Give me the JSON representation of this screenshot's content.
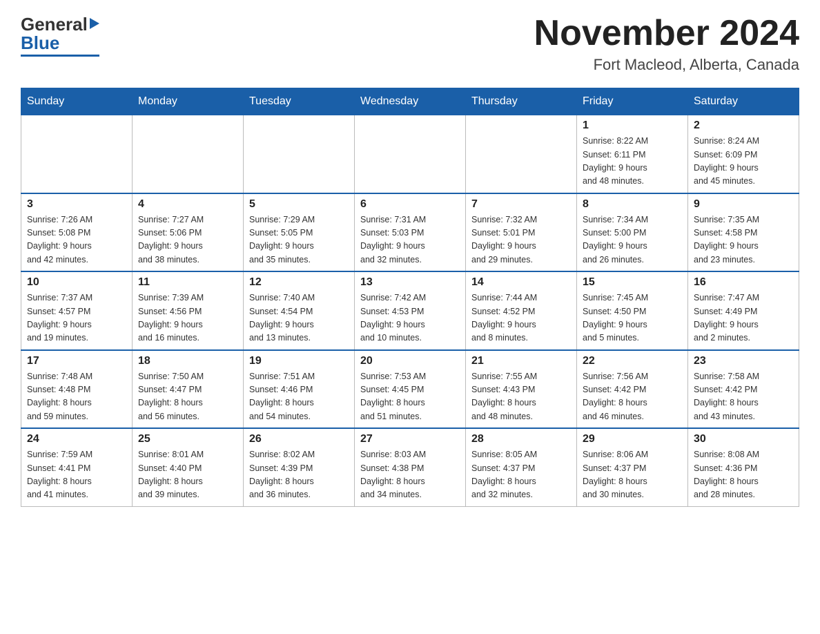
{
  "header": {
    "logo_black": "General",
    "logo_blue": "Blue",
    "title": "November 2024",
    "subtitle": "Fort Macleod, Alberta, Canada"
  },
  "weekdays": [
    "Sunday",
    "Monday",
    "Tuesday",
    "Wednesday",
    "Thursday",
    "Friday",
    "Saturday"
  ],
  "weeks": [
    [
      {
        "day": "",
        "info": ""
      },
      {
        "day": "",
        "info": ""
      },
      {
        "day": "",
        "info": ""
      },
      {
        "day": "",
        "info": ""
      },
      {
        "day": "",
        "info": ""
      },
      {
        "day": "1",
        "info": "Sunrise: 8:22 AM\nSunset: 6:11 PM\nDaylight: 9 hours\nand 48 minutes."
      },
      {
        "day": "2",
        "info": "Sunrise: 8:24 AM\nSunset: 6:09 PM\nDaylight: 9 hours\nand 45 minutes."
      }
    ],
    [
      {
        "day": "3",
        "info": "Sunrise: 7:26 AM\nSunset: 5:08 PM\nDaylight: 9 hours\nand 42 minutes."
      },
      {
        "day": "4",
        "info": "Sunrise: 7:27 AM\nSunset: 5:06 PM\nDaylight: 9 hours\nand 38 minutes."
      },
      {
        "day": "5",
        "info": "Sunrise: 7:29 AM\nSunset: 5:05 PM\nDaylight: 9 hours\nand 35 minutes."
      },
      {
        "day": "6",
        "info": "Sunrise: 7:31 AM\nSunset: 5:03 PM\nDaylight: 9 hours\nand 32 minutes."
      },
      {
        "day": "7",
        "info": "Sunrise: 7:32 AM\nSunset: 5:01 PM\nDaylight: 9 hours\nand 29 minutes."
      },
      {
        "day": "8",
        "info": "Sunrise: 7:34 AM\nSunset: 5:00 PM\nDaylight: 9 hours\nand 26 minutes."
      },
      {
        "day": "9",
        "info": "Sunrise: 7:35 AM\nSunset: 4:58 PM\nDaylight: 9 hours\nand 23 minutes."
      }
    ],
    [
      {
        "day": "10",
        "info": "Sunrise: 7:37 AM\nSunset: 4:57 PM\nDaylight: 9 hours\nand 19 minutes."
      },
      {
        "day": "11",
        "info": "Sunrise: 7:39 AM\nSunset: 4:56 PM\nDaylight: 9 hours\nand 16 minutes."
      },
      {
        "day": "12",
        "info": "Sunrise: 7:40 AM\nSunset: 4:54 PM\nDaylight: 9 hours\nand 13 minutes."
      },
      {
        "day": "13",
        "info": "Sunrise: 7:42 AM\nSunset: 4:53 PM\nDaylight: 9 hours\nand 10 minutes."
      },
      {
        "day": "14",
        "info": "Sunrise: 7:44 AM\nSunset: 4:52 PM\nDaylight: 9 hours\nand 8 minutes."
      },
      {
        "day": "15",
        "info": "Sunrise: 7:45 AM\nSunset: 4:50 PM\nDaylight: 9 hours\nand 5 minutes."
      },
      {
        "day": "16",
        "info": "Sunrise: 7:47 AM\nSunset: 4:49 PM\nDaylight: 9 hours\nand 2 minutes."
      }
    ],
    [
      {
        "day": "17",
        "info": "Sunrise: 7:48 AM\nSunset: 4:48 PM\nDaylight: 8 hours\nand 59 minutes."
      },
      {
        "day": "18",
        "info": "Sunrise: 7:50 AM\nSunset: 4:47 PM\nDaylight: 8 hours\nand 56 minutes."
      },
      {
        "day": "19",
        "info": "Sunrise: 7:51 AM\nSunset: 4:46 PM\nDaylight: 8 hours\nand 54 minutes."
      },
      {
        "day": "20",
        "info": "Sunrise: 7:53 AM\nSunset: 4:45 PM\nDaylight: 8 hours\nand 51 minutes."
      },
      {
        "day": "21",
        "info": "Sunrise: 7:55 AM\nSunset: 4:43 PM\nDaylight: 8 hours\nand 48 minutes."
      },
      {
        "day": "22",
        "info": "Sunrise: 7:56 AM\nSunset: 4:42 PM\nDaylight: 8 hours\nand 46 minutes."
      },
      {
        "day": "23",
        "info": "Sunrise: 7:58 AM\nSunset: 4:42 PM\nDaylight: 8 hours\nand 43 minutes."
      }
    ],
    [
      {
        "day": "24",
        "info": "Sunrise: 7:59 AM\nSunset: 4:41 PM\nDaylight: 8 hours\nand 41 minutes."
      },
      {
        "day": "25",
        "info": "Sunrise: 8:01 AM\nSunset: 4:40 PM\nDaylight: 8 hours\nand 39 minutes."
      },
      {
        "day": "26",
        "info": "Sunrise: 8:02 AM\nSunset: 4:39 PM\nDaylight: 8 hours\nand 36 minutes."
      },
      {
        "day": "27",
        "info": "Sunrise: 8:03 AM\nSunset: 4:38 PM\nDaylight: 8 hours\nand 34 minutes."
      },
      {
        "day": "28",
        "info": "Sunrise: 8:05 AM\nSunset: 4:37 PM\nDaylight: 8 hours\nand 32 minutes."
      },
      {
        "day": "29",
        "info": "Sunrise: 8:06 AM\nSunset: 4:37 PM\nDaylight: 8 hours\nand 30 minutes."
      },
      {
        "day": "30",
        "info": "Sunrise: 8:08 AM\nSunset: 4:36 PM\nDaylight: 8 hours\nand 28 minutes."
      }
    ]
  ]
}
